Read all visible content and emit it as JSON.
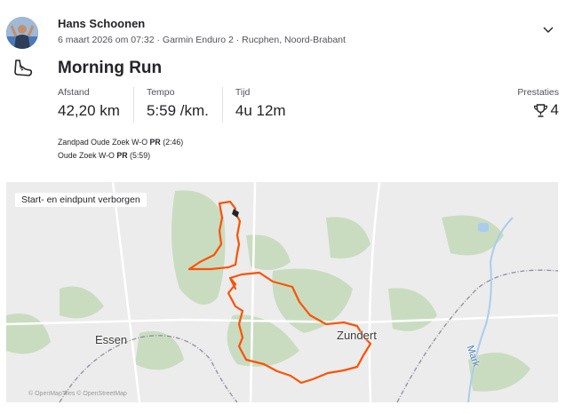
{
  "athlete": {
    "name": "Hans Schoonen",
    "meta": "6 maart 2026 om 07:32 · Garmin Enduro 2 · Rucphen, Noord-Brabant"
  },
  "activity": {
    "title": "Morning Run",
    "stats": [
      {
        "label": "Afstand",
        "value": "42,20 km"
      },
      {
        "label": "Tempo",
        "value": "5:59 /km."
      },
      {
        "label": "Tijd",
        "value": "4u 12m"
      }
    ],
    "achievements": {
      "label": "Prestaties",
      "count": "4"
    }
  },
  "segments": [
    {
      "name": "Zandpad Oude Zoek W-O",
      "badge": "PR",
      "time": "(2:46)"
    },
    {
      "name": "Oude Zoek W-O",
      "badge": "PR",
      "time": "(5:59)"
    }
  ],
  "map": {
    "privacy_label": "Start- en eindpunt verborgen",
    "labels": {
      "west_town": "Essen",
      "east_town": "Zundert",
      "river": "Mark"
    },
    "attribution": "© OpenMapTiles © OpenStreetMap",
    "route_color": "#fc5200",
    "forest_color": "#c9dcc0",
    "water_color": "#a9cdee",
    "border_color": "#8e8e9e"
  },
  "icons": {
    "menu": "chevron-down-icon",
    "activity_type": "running-shoe-icon",
    "achievements": "trophy-icon"
  }
}
